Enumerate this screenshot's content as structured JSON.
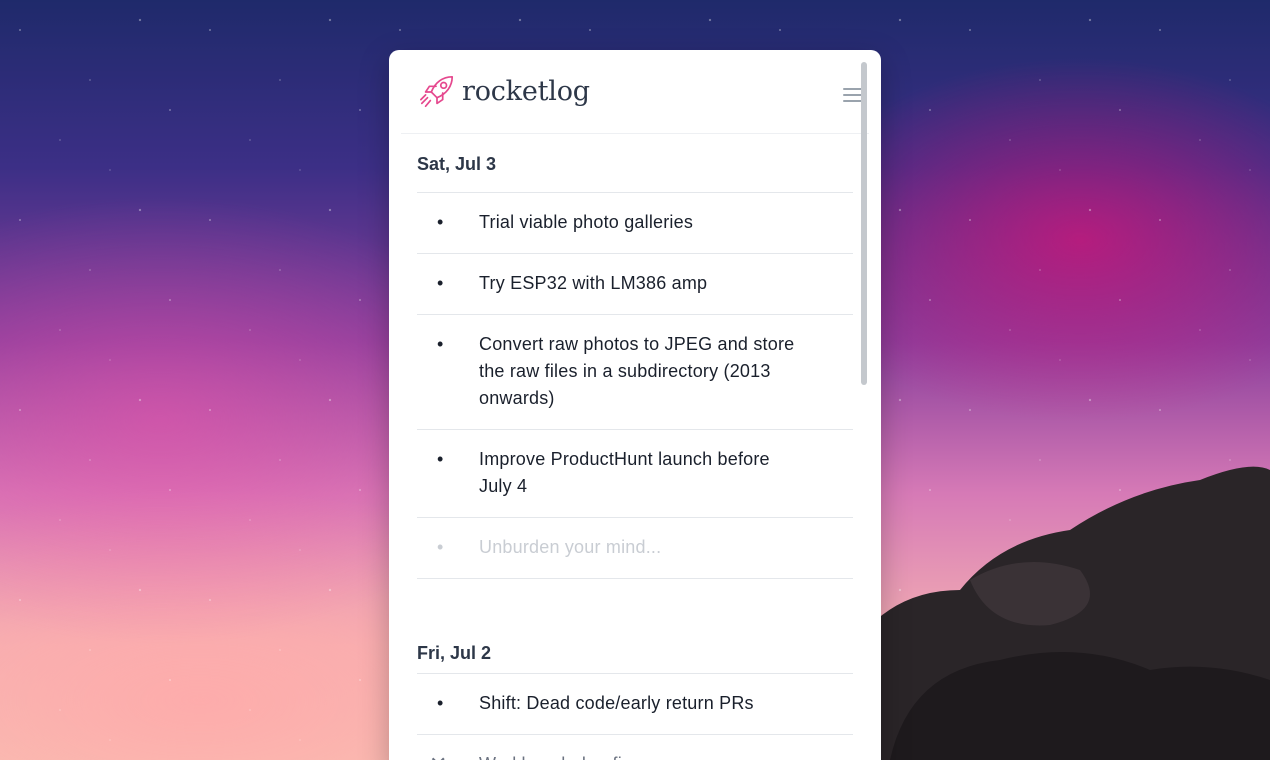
{
  "app": {
    "name": "rocketlog",
    "logo_icon": "rocket-icon",
    "menu_icon": "hamburger-menu-icon",
    "accent_color": "#e5488e"
  },
  "days": [
    {
      "label": "Sat, Jul 3",
      "entries": [
        {
          "bullet": "•",
          "text": "Trial viable photo galleries"
        },
        {
          "bullet": "•",
          "text": "Try ESP32 with LM386 amp"
        },
        {
          "bullet": "•",
          "text": "Convert raw photos to JPEG and store the raw files in a subdirectory (2013 onwards)"
        },
        {
          "bullet": "•",
          "text": "Improve ProductHunt launch before July 4"
        }
      ],
      "new_entry": {
        "bullet": "•",
        "placeholder": "Unburden your mind..."
      }
    },
    {
      "label": "Fri, Jul 2",
      "entries": [
        {
          "bullet": "•",
          "text": "Shift: Dead code/early return PRs"
        },
        {
          "bullet": "✕",
          "text": "Workbench: bugfixes",
          "status": "done"
        }
      ]
    }
  ]
}
